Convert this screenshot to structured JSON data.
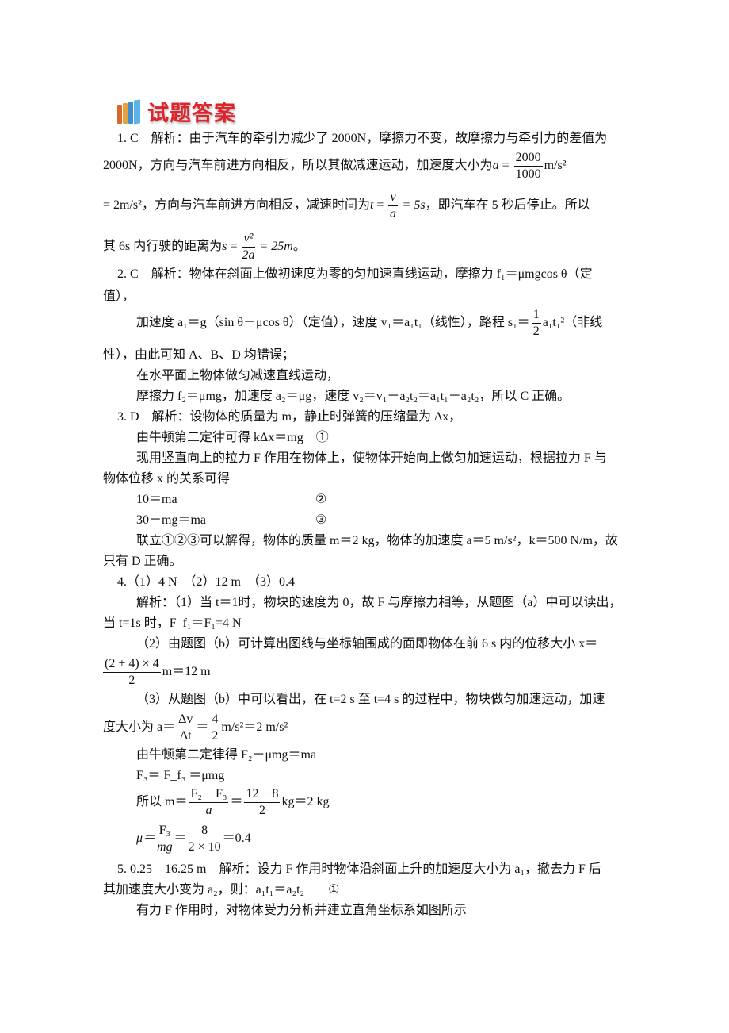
{
  "header": {
    "title": "试题答案",
    "icon": "books-icon"
  },
  "lines": {
    "l1": "1. C　解析：由于汽车的牵引力减少了 2000N，摩擦力不变，故摩擦力与牵引力的差值为",
    "l2a": "2000N，方向与汽车前进方向相反，所以其做减速运动，加速度大小为",
    "l2_var": "a",
    "l2_eq": " = ",
    "l2_num": "2000",
    "l2_den": "1000",
    "l2_unit": "m/s²",
    "l3a": "= 2m/s²，方向与汽车前进方向相反，减速时间为",
    "l3_var": "t",
    "l3_eq": " = ",
    "l3_num": "v",
    "l3_den": "a",
    "l3_res": " = 5s",
    "l3b": "，即汽车在 5 秒后停止。所以",
    "l4a": "其 6s 内行驶的距离为",
    "l4_var": "s",
    "l4_eq": " = ",
    "l4_num": "v²",
    "l4_den": "2a",
    "l4_res": " = 25m",
    "l4b": "。",
    "l5": "2. C　解析：物体在斜面上做初速度为零的匀加速直线运动，摩擦力 f₁＝μmgcos θ（定",
    "l6": "值），",
    "l7a": "加速度 a₁＝g（sin θ－μcos θ）（定值），速度 v₁＝a₁t₁（线性），路程 s₁＝",
    "l7_num": "1",
    "l7_den": "2",
    "l7b": "a₁t₁²（非线",
    "l8": "性），由此可知 A、B、D 均错误；",
    "l9": "在水平面上物体做匀减速直线运动，",
    "l10": "摩擦力 f₂＝μmg，加速度 a₂＝μg，速度 v₂＝v₁－a₂t₂＝a₁t₁－a₂t₂，所以 C 正确。",
    "l11": "3. D　解析：设物体的质量为 m，静止时弹簧的压缩量为 Δx，",
    "l12": "由牛顿第二定律可得 kΔx＝mg　①",
    "l13": "现用竖直向上的拉力 F 作用在物体上，使物体开始向上做匀加速运动，根据拉力 F 与",
    "l14": "物体位移 x 的关系可得",
    "l15a": "10＝ma",
    "l15b": "②",
    "l16a": "30－mg＝ma",
    "l16b": "③",
    "l17": "联立①②③可以解得，物体的质量 m＝2 kg，物体的加速度 a＝5 m/s²，k＝500 N/m，故",
    "l18": "只有 D 正确。",
    "l19": "4.（1）4 N　（2）12 m　（3）0.4",
    "l20": "解析：（1）当 t＝1时，物块的速度为 0，故 F 与摩擦力相等，从题图（a）中可以读出，",
    "l21": "当 t=1s 时，F_f₁＝F₁=4 N",
    "l22": "（2）由题图（b）可计算出图线与坐标轴围成的面即物体在前 6 s 内的位移大小 x＝",
    "l23_num": "(2 + 4) × 4",
    "l23_den": "2",
    "l23b": "m＝12 m",
    "l24": "（3）从题图（b）中可以看出，在 t=2 s 至 t=4 s 的过程中，物块做匀加速运动，加速",
    "l25a": "度大小为 a＝",
    "l25_num1": "Δv",
    "l25_den1": "Δt",
    "l25_eq": "＝",
    "l25_num2": "4",
    "l25_den2": "2",
    "l25b": "m/s²＝2 m/s²",
    "l26": "由牛顿第二定律得 F₂－μmg＝ma",
    "l27": "F₃＝ F_f₃ ＝μmg",
    "l28a": "所以 m＝",
    "l28_num1": "F₂ − F₃",
    "l28_den1": "a",
    "l28_eq": "＝",
    "l28_num2": "12 − 8",
    "l28_den2": "2",
    "l28b": "kg＝2 kg",
    "l29a": "μ＝",
    "l29_num1": "F₃",
    "l29_den1": "mg",
    "l29_eq": "＝",
    "l29_num2": "8",
    "l29_den2": "2 × 10",
    "l29b": "＝0.4",
    "l30": "5. 0.25　16.25 m　解析：设力 F 作用时物体沿斜面上升的加速度大小为 a₁，撤去力 F 后",
    "l31a": "其加速度大小变为 a₂，则：a₁t₁＝a₂t₂",
    "l31b": "①",
    "l32": "有力 F 作用时，对物体受力分析并建立直角坐标系如图所示"
  }
}
